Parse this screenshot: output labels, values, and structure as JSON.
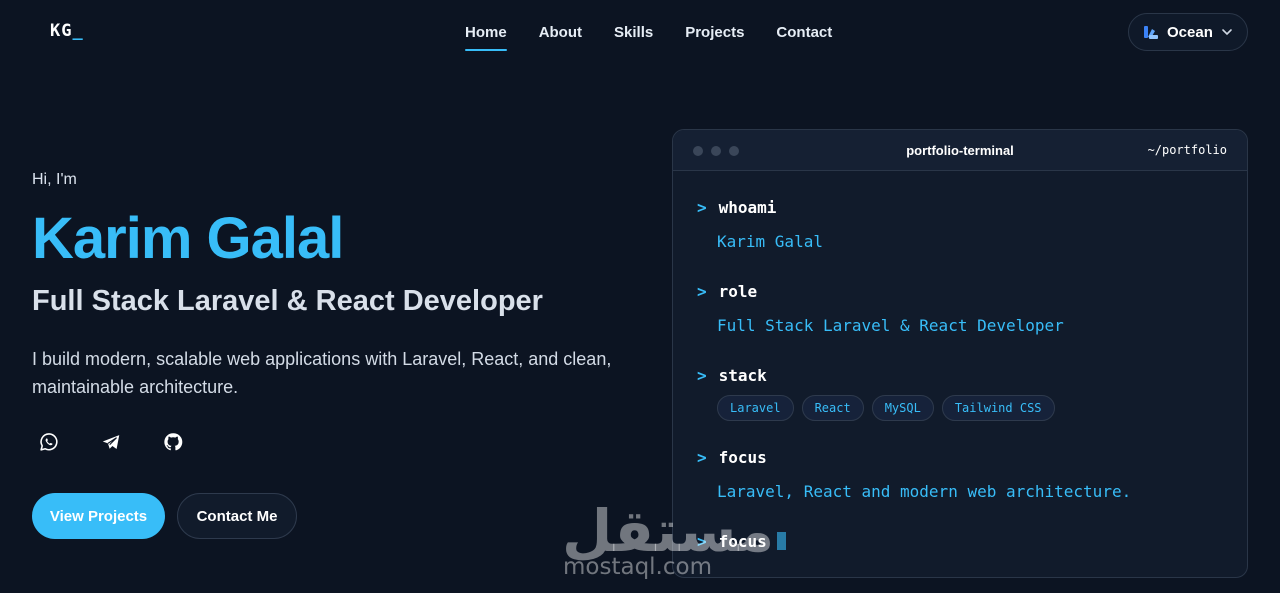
{
  "nav": {
    "logo": "KG",
    "logo_cursor": "_",
    "links": [
      "Home",
      "About",
      "Skills",
      "Projects",
      "Contact"
    ],
    "active": "Home",
    "theme": {
      "label": "Ocean",
      "icon": "palette-icon"
    }
  },
  "hero": {
    "greeting": "Hi, I'm",
    "name": "Karim Galal",
    "role": "Full Stack Laravel & React Developer",
    "description": "I build modern, scalable web applications with Laravel, React, and clean, maintainable architecture.",
    "socials": [
      "whatsapp-icon",
      "telegram-icon",
      "github-icon"
    ],
    "primary_button": "View Projects",
    "secondary_button": "Contact Me"
  },
  "terminal": {
    "title": "portfolio-terminal",
    "path": "~/portfolio",
    "prompt": ">",
    "entries": [
      {
        "command": "whoami",
        "output": "Karim Galal"
      },
      {
        "command": "role",
        "output": "Full Stack Laravel & React Developer"
      },
      {
        "command": "stack",
        "chips": [
          "Laravel",
          "React",
          "MySQL",
          "Tailwind CSS"
        ]
      },
      {
        "command": "focus",
        "output": "Laravel, React and modern web architecture."
      }
    ],
    "current_command": "focus"
  },
  "watermark": {
    "arabic": "مستقل",
    "latin": "mostaql.com"
  },
  "colors": {
    "accent": "#38bdf8",
    "background": "#0c1422",
    "panel": "#111b2b"
  }
}
